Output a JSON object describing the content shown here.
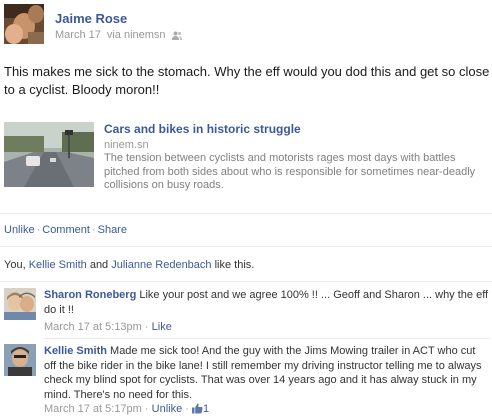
{
  "post": {
    "author": "Jaime Rose",
    "date": "March 17",
    "via": "via ninemsn",
    "privacy_icon": "friends-icon",
    "message": "This makes me sick to the stomach. Why the eff would you dod this and get so close to a cyclist. Bloody moron!!"
  },
  "attachment": {
    "title": "Cars and bikes in historic struggle",
    "source": "ninem.sn",
    "description": "The tension between cyclists and motorists rages most days with battles pitched from both sides about who is responsible for sometimes near-deadly collisions on busy roads."
  },
  "actions": {
    "unlike": "Unlike",
    "comment": "Comment",
    "share": "Share",
    "separator": "·"
  },
  "likes": {
    "prefix": "You, ",
    "person1": "Kellie Smith",
    "and": " and ",
    "person2": "Julianne Redenbach",
    "suffix": " like this."
  },
  "comments": [
    {
      "author": "Sharon Roneberg",
      "text": "Like your post and we agree 100% !! ... Geoff and Sharon ... why the eff do it !!",
      "time": "March 17 at 5:13pm",
      "action": "Like",
      "like_count": ""
    },
    {
      "author": "Kellie Smith",
      "text": "Made me sick too! And the guy with the Jims Mowing trailer in ACT who cut off the bike rider in the bike lane! I still remember my driving instructor telling me to always check my blind spot for cyclists. That was over 14 years ago and it has alway stuck in my mind. There's no need for this.",
      "time": "March 17 at 5:17pm",
      "action": "Unlike",
      "like_count": "1"
    }
  ],
  "colors": {
    "link": "#3b5998",
    "meta": "#999999",
    "divider": "#e9e9e9"
  }
}
